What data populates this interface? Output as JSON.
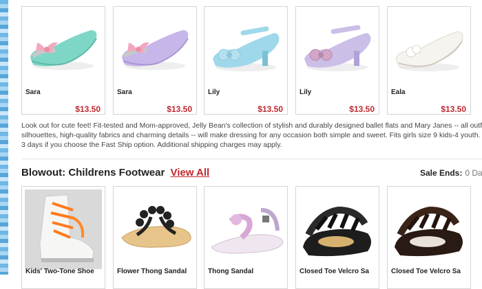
{
  "top_products": [
    {
      "name": "Sara",
      "price": "$13.50"
    },
    {
      "name": "Sara",
      "price": "$13.50"
    },
    {
      "name": "Lily",
      "price": "$13.50"
    },
    {
      "name": "Lily",
      "price": "$13.50"
    },
    {
      "name": "Eala",
      "price": "$13.50"
    }
  ],
  "description": {
    "lines": [
      "Look out for cute feet! Fit-tested and Mom-approved, Jelly Bean's collection of stylish and durably designed ballet flats and Mary Janes -- all outfitt",
      "silhouettes, high-quality fabrics and charming details -- will make dressing for any occasion both simple and sweet. Fits girls size 9 kids-4 youth. T",
      "3 days if you choose the Fast Ship option. Additional shipping charges may apply."
    ]
  },
  "section": {
    "title": "Blowout: Childrens Footwear",
    "view_all": "View All",
    "sale_label": "Sale Ends:",
    "sale_value": "0 Da"
  },
  "bottom_products": [
    {
      "name": "Kids' Two-Tone Shoe"
    },
    {
      "name": "Flower Thong Sandal"
    },
    {
      "name": "Thong Sandal"
    },
    {
      "name": "Closed Toe Velcro Sa"
    },
    {
      "name": "Closed Toe Velcro Sa"
    }
  ],
  "colors": {
    "price": "#c0272d",
    "accent_stripe": "#6fb7e6"
  }
}
